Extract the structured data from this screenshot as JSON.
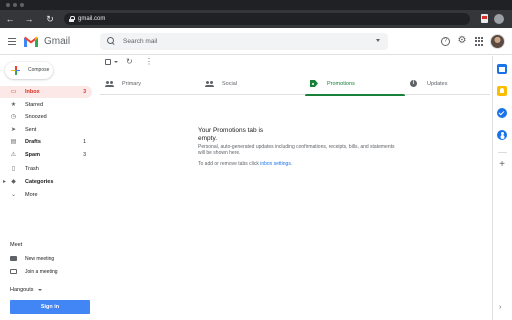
{
  "browser": {
    "url": "gmail.com"
  },
  "header": {
    "app_name": "Gmail",
    "search_placeholder": "Search mail"
  },
  "compose": {
    "label": "Compose"
  },
  "sidebar": {
    "items": [
      {
        "label": "Inbox",
        "count": "3",
        "icon": "inbox-icon"
      },
      {
        "label": "Starred",
        "count": "",
        "icon": "star-icon"
      },
      {
        "label": "Snoozed",
        "count": "",
        "icon": "clock-icon"
      },
      {
        "label": "Sent",
        "count": "",
        "icon": "send-icon"
      },
      {
        "label": "Drafts",
        "count": "1",
        "icon": "draft-icon"
      },
      {
        "label": "Spam",
        "count": "3",
        "icon": "spam-icon"
      },
      {
        "label": "Trash",
        "count": "",
        "icon": "trash-icon"
      },
      {
        "label": "Categories",
        "count": "",
        "icon": "label-icon"
      },
      {
        "label": "More",
        "count": "",
        "icon": "chevron-down-icon"
      }
    ]
  },
  "meet": {
    "title": "Meet",
    "items": [
      {
        "label": "New meeting",
        "icon": "video-icon"
      },
      {
        "label": "Join a meeting",
        "icon": "keyboard-icon"
      }
    ]
  },
  "hangouts": {
    "title": "Hangouts",
    "signin_label": "Sign in"
  },
  "tabs": [
    {
      "label": "Primary",
      "icon": "people-icon",
      "active": false
    },
    {
      "label": "Social",
      "icon": "people-icon",
      "active": false
    },
    {
      "label": "Promotions",
      "icon": "tag-icon",
      "active": true
    },
    {
      "label": "Updates",
      "icon": "info-icon",
      "active": false
    }
  ],
  "empty_state": {
    "title": "Your Promotions tab is empty.",
    "description": "Personal, auto-generated updates including confirmations, receipts, bills, and statements will be shown here.",
    "hint_prefix": "To add or remove tabs click ",
    "hint_link": "inbox settings",
    "hint_suffix": "."
  },
  "colors": {
    "active_red": "#d93025",
    "active_bg": "#fce8e6",
    "promotions_green": "#188038",
    "link_blue": "#1a73e8",
    "signin_blue": "#4285f4"
  }
}
